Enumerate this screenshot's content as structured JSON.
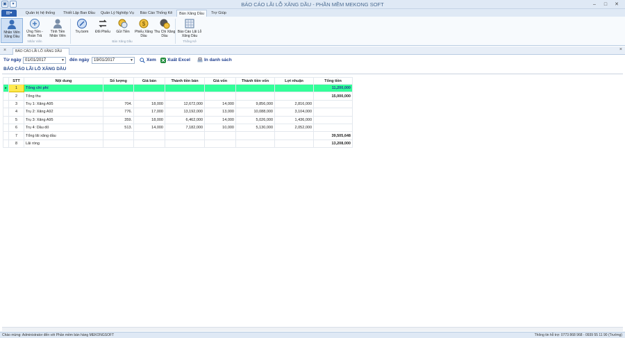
{
  "window": {
    "title": "BÁO CÁO LÃI LỖ XĂNG DẦU - PHẦN MỀM MEKONG SOFT"
  },
  "menu": {
    "tabs": [
      "Quản trị hệ thống",
      "Thiết Lập Ban Đầu",
      "Quản Lý Nghiệp Vụ",
      "Báo Cáo Thống Kê",
      "Bán Xăng Dầu",
      "Trợ Giúp"
    ],
    "active_tab": "Bán Xăng Dầu"
  },
  "ribbon": {
    "buttons": [
      {
        "label": "Nhân Viên Xăng Dầu",
        "icon": "employee-icon"
      },
      {
        "label": "Ứng Tiền - Hoàn Trả",
        "icon": "advance-money-icon"
      },
      {
        "label": "Tính Tiền Nhân Viên",
        "icon": "calculate-pay-icon"
      },
      {
        "label": "Trụ bơm",
        "icon": "pump-icon"
      },
      {
        "label": "Đổi Phiếu",
        "icon": "exchange-icon"
      },
      {
        "label": "Gửi Tiền",
        "icon": "deposit-icon"
      },
      {
        "label": "Phiếu Xăng Dầu",
        "icon": "voucher-icon"
      },
      {
        "label": "Thu Chi Xăng Dầu",
        "icon": "income-expense-icon"
      },
      {
        "label": "Báo Cáo Lãi Lỗ Xăng Dầu",
        "icon": "report-icon"
      }
    ],
    "groups": [
      "Nhân Viên",
      "Bán Xăng Dầu",
      "Thống Kê"
    ]
  },
  "doc_tab": {
    "label": "BÁO CÁO LÃI LỖ XĂNG DẦU"
  },
  "filter": {
    "from_label": "Từ ngày",
    "from_value": "01/01/2017",
    "to_label": "đến ngày",
    "to_value": "19/01/2017",
    "view_label": "Xem",
    "excel_label": "Xuất Excel",
    "print_label": "In danh sách"
  },
  "report_title": "BÁO CÁO LÃI LỖ XĂNG DẦU",
  "grid": {
    "columns": [
      "STT",
      "Nội dung",
      "Số lượng",
      "Giá bán",
      "Thành tiền bán",
      "Giá vốn",
      "Thành tiền vốn",
      "Lợi nhuận",
      "Tổng tiền"
    ],
    "rows": [
      [
        "1",
        "Tổng chi phí",
        "",
        "",
        "",
        "",
        "",
        "",
        "11,200,000"
      ],
      [
        "2",
        "Tổng thu",
        "",
        "",
        "",
        "",
        "",
        "",
        "15,000,000"
      ],
      [
        "3",
        "Trụ 1: Xăng A95",
        "704.",
        "18,000",
        "12,672,000",
        "14,000",
        "9,856,000",
        "2,816,000",
        ""
      ],
      [
        "4",
        "Trụ 2: Xăng A92",
        "776.",
        "17,000",
        "13,192,000",
        "13,000",
        "10,088,000",
        "3,104,000",
        ""
      ],
      [
        "5",
        "Trụ 3: Xăng A95",
        "359.",
        "18,000",
        "6,462,000",
        "14,000",
        "5,026,000",
        "1,436,000",
        ""
      ],
      [
        "6",
        "Trụ 4: Dầu đỏ",
        "513.",
        "14,000",
        "7,182,000",
        "10,000",
        "5,130,000",
        "2,052,000",
        ""
      ],
      [
        "7",
        "Tổng lãi xăng dầu",
        "",
        "",
        "",
        "",
        "",
        "",
        "39,505,648"
      ],
      [
        "8",
        "Lãi ròng",
        "",
        "",
        "",
        "",
        "",
        "",
        "13,208,000"
      ]
    ]
  },
  "status": {
    "left": "Chào mừng: Administrator đến với Phần mềm bán hàng MEKONGSOFT",
    "right": "Thông tin hỗ trợ: 0773 868 968 - 0939 55 11 90 (Trường)"
  },
  "colors": {
    "highlight_row": "#33ff99",
    "stt_highlight": "#ffe94d",
    "accent": "#1f3f8f"
  }
}
